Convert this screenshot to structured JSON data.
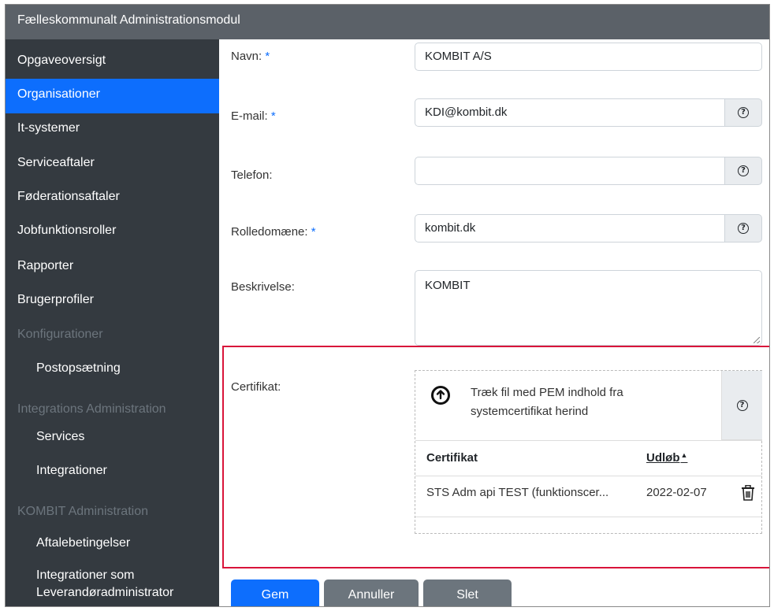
{
  "app": {
    "title": "Fælleskommunalt Administrationsmodul"
  },
  "sidebar": {
    "items": [
      {
        "label": "Opgaveoversigt"
      },
      {
        "label": "Organisationer"
      },
      {
        "label": "It-systemer"
      },
      {
        "label": "Serviceaftaler"
      },
      {
        "label": "Føderationsaftaler"
      },
      {
        "label": "Jobfunktionsroller"
      },
      {
        "label": "Rapporter"
      },
      {
        "label": "Brugerprofiler"
      },
      {
        "label": "Konfigurationer"
      },
      {
        "label": "Postopsætning"
      },
      {
        "label": "Integrations Administration"
      },
      {
        "label": "Services"
      },
      {
        "label": "Integrationer"
      },
      {
        "label": "KOMBIT Administration"
      },
      {
        "label": "Aftalebetingelser"
      },
      {
        "label": "Integrationer som"
      },
      {
        "label": "Leverandøradministrator"
      }
    ]
  },
  "form": {
    "required_marker": "*",
    "name": {
      "label": "Navn:",
      "value": "KOMBIT A/S"
    },
    "email": {
      "label": "E-mail:",
      "value": "KDI@kombit.dk"
    },
    "phone": {
      "label": "Telefon:",
      "value": ""
    },
    "role_domain": {
      "label": "Rolledomæne:",
      "value": "kombit.dk"
    },
    "description": {
      "label": "Beskrivelse:",
      "value": "KOMBIT"
    },
    "certificate": {
      "label": "Certifikat:",
      "drop_text_line1": "Træk fil med PEM indhold fra",
      "drop_text_line2": "systemcertifikat herind",
      "table": {
        "headers": {
          "certificate": "Certifikat",
          "expiry": "Udløb"
        },
        "rows": [
          {
            "certificate": "STS Adm api TEST (funktionscer...",
            "expiry": "2022-02-07"
          }
        ]
      }
    }
  },
  "help_symbol": "?",
  "buttons": {
    "save": "Gem",
    "cancel": "Annuller",
    "delete": "Slet"
  },
  "colors": {
    "primary": "#0d6efd",
    "secondary": "#6c757d",
    "sidebar": "#343a40",
    "highlight": "#d9143a"
  }
}
